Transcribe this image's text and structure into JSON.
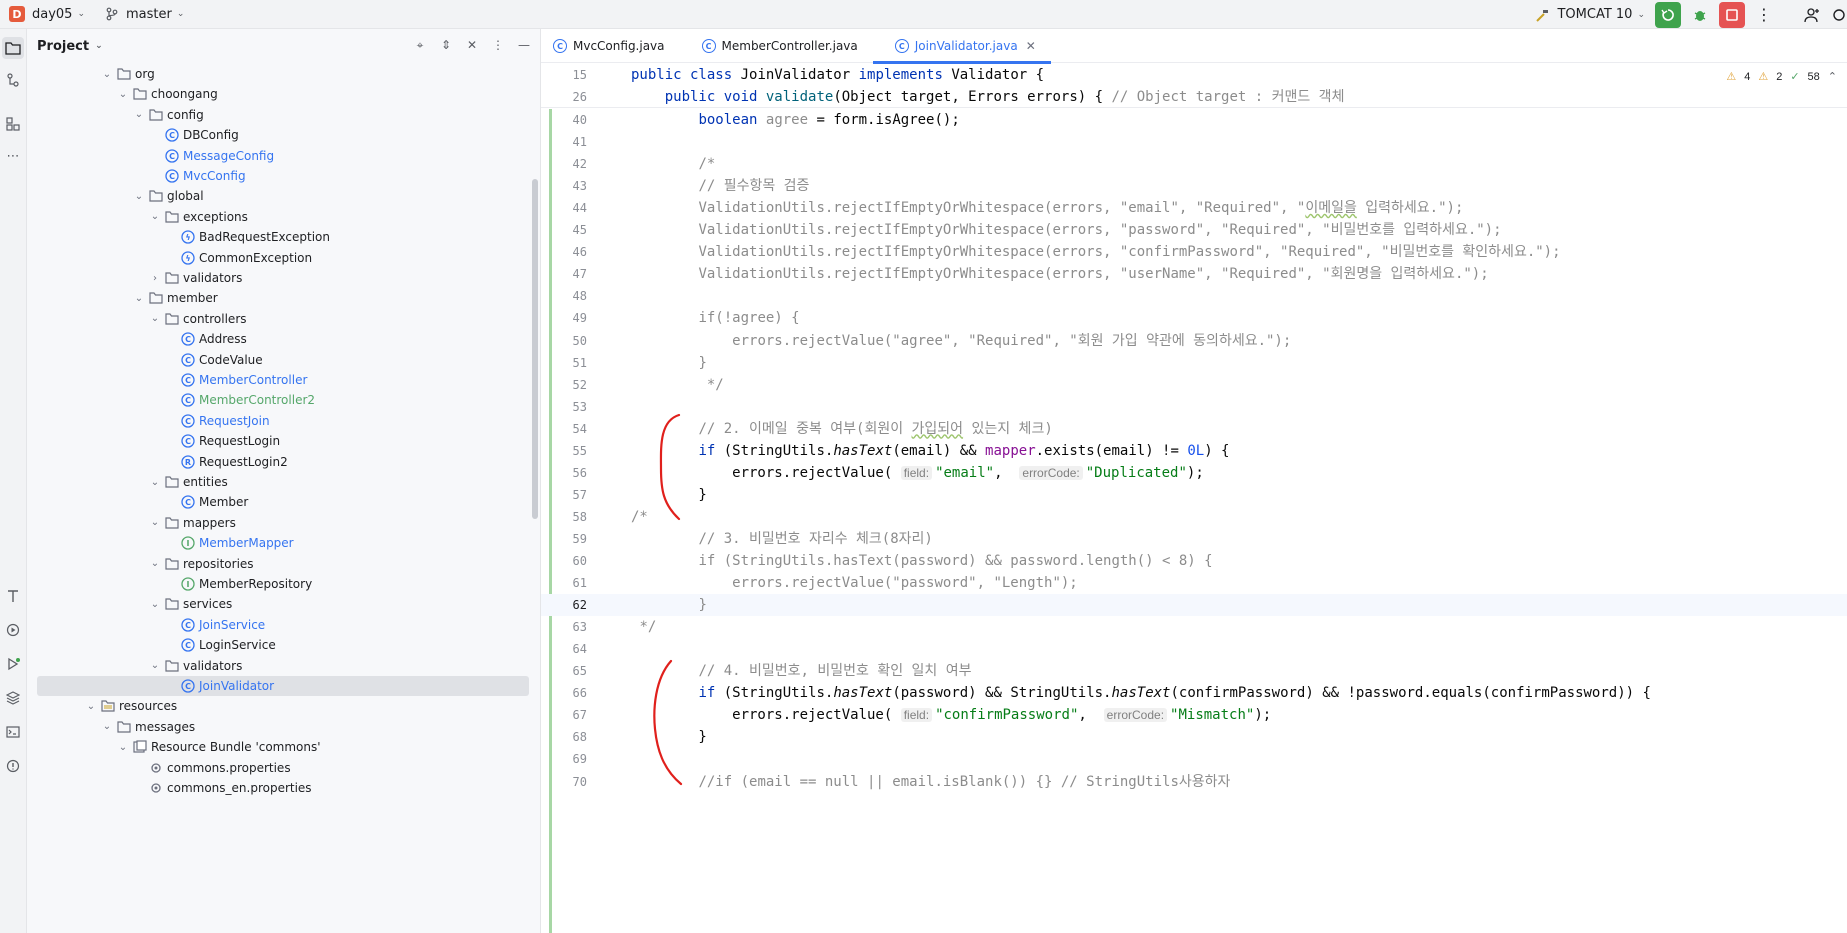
{
  "titlebar": {
    "project_badge": "D",
    "project_name": "day05",
    "branch": "master",
    "run_config": "TOMCAT 10",
    "icons": [
      "hammer-icon",
      "run-icon",
      "debug-icon",
      "stop-icon",
      "more-icon",
      "add-user-icon"
    ]
  },
  "project_panel": {
    "title": "Project",
    "tree": [
      {
        "label": "org",
        "depth": 4,
        "type": "folder",
        "expanded": true
      },
      {
        "label": "choongang",
        "depth": 5,
        "type": "folder",
        "expanded": true
      },
      {
        "label": "config",
        "depth": 6,
        "type": "folder",
        "expanded": true
      },
      {
        "label": "DBConfig",
        "depth": 7,
        "type": "class",
        "color": "default"
      },
      {
        "label": "MessageConfig",
        "depth": 7,
        "type": "class",
        "color": "blue"
      },
      {
        "label": "MvcConfig",
        "depth": 7,
        "type": "class",
        "color": "blue"
      },
      {
        "label": "global",
        "depth": 6,
        "type": "folder",
        "expanded": true
      },
      {
        "label": "exceptions",
        "depth": 7,
        "type": "folder",
        "expanded": true
      },
      {
        "label": "BadRequestException",
        "depth": 8,
        "type": "exception",
        "color": "default"
      },
      {
        "label": "CommonException",
        "depth": 8,
        "type": "exception",
        "color": "default"
      },
      {
        "label": "validators",
        "depth": 7,
        "type": "folder",
        "expanded": false
      },
      {
        "label": "member",
        "depth": 6,
        "type": "folder",
        "expanded": true
      },
      {
        "label": "controllers",
        "depth": 7,
        "type": "folder",
        "expanded": true
      },
      {
        "label": "Address",
        "depth": 8,
        "type": "class",
        "color": "default"
      },
      {
        "label": "CodeValue",
        "depth": 8,
        "type": "class",
        "color": "default"
      },
      {
        "label": "MemberController",
        "depth": 8,
        "type": "class",
        "color": "blue"
      },
      {
        "label": "MemberController2",
        "depth": 8,
        "type": "class",
        "color": "green"
      },
      {
        "label": "RequestJoin",
        "depth": 8,
        "type": "class",
        "color": "blue"
      },
      {
        "label": "RequestLogin",
        "depth": 8,
        "type": "class",
        "color": "default"
      },
      {
        "label": "RequestLogin2",
        "depth": 8,
        "type": "record",
        "color": "default"
      },
      {
        "label": "entities",
        "depth": 7,
        "type": "folder",
        "expanded": true
      },
      {
        "label": "Member",
        "depth": 8,
        "type": "class",
        "color": "default"
      },
      {
        "label": "mappers",
        "depth": 7,
        "type": "folder",
        "expanded": true
      },
      {
        "label": "MemberMapper",
        "depth": 8,
        "type": "interface",
        "color": "blue"
      },
      {
        "label": "repositories",
        "depth": 7,
        "type": "folder",
        "expanded": true
      },
      {
        "label": "MemberRepository",
        "depth": 8,
        "type": "interface",
        "color": "default"
      },
      {
        "label": "services",
        "depth": 7,
        "type": "folder",
        "expanded": true
      },
      {
        "label": "JoinService",
        "depth": 8,
        "type": "class",
        "color": "blue"
      },
      {
        "label": "LoginService",
        "depth": 8,
        "type": "class",
        "color": "default"
      },
      {
        "label": "validators",
        "depth": 7,
        "type": "folder",
        "expanded": true
      },
      {
        "label": "JoinValidator",
        "depth": 8,
        "type": "class",
        "color": "blue",
        "selected": true
      },
      {
        "label": "resources",
        "depth": 3,
        "type": "resfolder",
        "expanded": true
      },
      {
        "label": "messages",
        "depth": 4,
        "type": "folder",
        "expanded": true
      },
      {
        "label": "Resource Bundle 'commons'",
        "depth": 5,
        "type": "bundle",
        "expanded": true
      },
      {
        "label": "commons.properties",
        "depth": 6,
        "type": "properties",
        "color": "default"
      },
      {
        "label": "commons_en.properties",
        "depth": 6,
        "type": "properties",
        "color": "default"
      }
    ]
  },
  "editor": {
    "tabs": [
      {
        "label": "MvcConfig.java",
        "active": false
      },
      {
        "label": "MemberController.java",
        "active": false
      },
      {
        "label": "JoinValidator.java",
        "active": true
      }
    ],
    "inspections": {
      "warnings": "4",
      "weak_warnings": "2",
      "ok": "58"
    },
    "sticky_lines": [
      {
        "n": "15",
        "html": "<span class=\"kw\">public class</span> JoinValidator <span class=\"kw\">implements</span> Validator {"
      },
      {
        "n": "26",
        "html": "    <span class=\"kw\">public void</span> <span class=\"fn\">validate</span>(Object target, Errors errors) { <span class=\"cm\">// Object target : 커맨드 객체</span>"
      }
    ],
    "current_line": "62",
    "lines": [
      {
        "n": "40",
        "html": "        <span class=\"kw\">boolean</span> <span class=\"cm\">agree</span> = form.isAgree();"
      },
      {
        "n": "41",
        "html": ""
      },
      {
        "n": "42",
        "html": "        <span class=\"cm\">/*</span>"
      },
      {
        "n": "43",
        "html": "        <span class=\"cm\">// 필수항목 검증</span>"
      },
      {
        "n": "44",
        "html": "        <span class=\"cm\">ValidationUtils.rejectIfEmptyOrWhitespace(errors, \"email\", \"Required\", \"<span class=\"warn-u\">이메일을</span> 입력하세요.\");</span>"
      },
      {
        "n": "45",
        "html": "        <span class=\"cm\">ValidationUtils.rejectIfEmptyOrWhitespace(errors, \"password\", \"Required\", \"비밀번호를 입력하세요.\");</span>"
      },
      {
        "n": "46",
        "html": "        <span class=\"cm\">ValidationUtils.rejectIfEmptyOrWhitespace(errors, \"confirmPassword\", \"Required\", \"비밀번호를 확인하세요.\");</span>"
      },
      {
        "n": "47",
        "html": "        <span class=\"cm\">ValidationUtils.rejectIfEmptyOrWhitespace(errors, \"userName\", \"Required\", \"회원명을 입력하세요.\");</span>"
      },
      {
        "n": "48",
        "html": ""
      },
      {
        "n": "49",
        "html": "        <span class=\"cm\">if(!agree) {</span>"
      },
      {
        "n": "50",
        "html": "            <span class=\"cm\">errors.rejectValue(\"agree\", \"Required\", \"회원 가입 약관에 동의하세요.\");</span>"
      },
      {
        "n": "51",
        "html": "        <span class=\"cm\">}</span>"
      },
      {
        "n": "52",
        "html": "         <span class=\"cm\">*/</span>"
      },
      {
        "n": "53",
        "html": ""
      },
      {
        "n": "54",
        "html": "        <span class=\"cm\">// 2. 이메일 중복 여부(회원이 <span class=\"warn-u\">가입되어</span> 있는지 체크)</span>"
      },
      {
        "n": "55",
        "html": "        <span class=\"kw\">if</span> (StringUtils.<span class=\"it\">hasText</span>(email) &amp;&amp; <span class=\"mp\">mapper</span>.exists(email) != <span class=\"nm\">0L</span>) {"
      },
      {
        "n": "56",
        "html": "            errors.rejectValue( <span class=\"hint\">field:</span><span class=\"st\">\"email\"</span>,  <span class=\"hint\">errorCode:</span><span class=\"st\">\"Duplicated\"</span>);"
      },
      {
        "n": "57",
        "html": "        }"
      },
      {
        "n": "58",
        "html": "<span class=\"cm\">/*</span>"
      },
      {
        "n": "59",
        "html": "        <span class=\"cm\">// 3. 비밀번호 자리수 체크(8자리)</span>"
      },
      {
        "n": "60",
        "html": "        <span class=\"cm\">if (StringUtils.hasText(password) &amp;&amp; password.length() &lt; 8) {</span>"
      },
      {
        "n": "61",
        "html": "            <span class=\"cm\">errors.rejectValue(\"password\", \"Length\");</span>"
      },
      {
        "n": "62",
        "html": "        <span class=\"cm\">}</span>"
      },
      {
        "n": "63",
        "html": " <span class=\"cm\">*/</span>"
      },
      {
        "n": "64",
        "html": ""
      },
      {
        "n": "65",
        "html": "        <span class=\"cm\">// 4. 비밀번호, 비밀번호 확인 일치 여부</span>"
      },
      {
        "n": "66",
        "html": "        <span class=\"kw\">if</span> (StringUtils.<span class=\"it\">hasText</span>(password) &amp;&amp; StringUtils.<span class=\"it\">hasText</span>(confirmPassword) &amp;&amp; !password.equals(confirmPassword)) {"
      },
      {
        "n": "67",
        "html": "            errors.rejectValue( <span class=\"hint\">field:</span><span class=\"st\">\"confirmPassword\"</span>,  <span class=\"hint\">errorCode:</span><span class=\"st\">\"Mismatch\"</span>);"
      },
      {
        "n": "68",
        "html": "        }"
      },
      {
        "n": "69",
        "html": ""
      },
      {
        "n": "70",
        "html": "        <span class=\"cm\">//if (email == null || email.isBlank()) {} // StringUtils사용하자</span>"
      }
    ]
  },
  "colors": {
    "accent": "#3574f0",
    "annotation_red": "#e0201c",
    "vcs_added": "#a7d7a5"
  }
}
